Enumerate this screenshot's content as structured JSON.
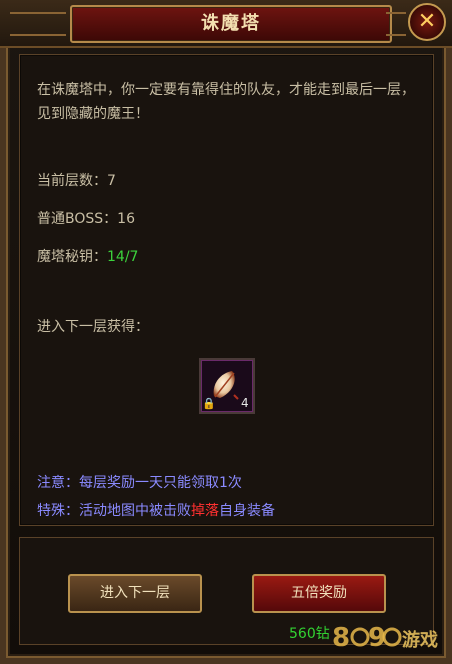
{
  "window": {
    "title": "诛魔塔"
  },
  "description": "在诛魔塔中，你一定要有靠得住的队友，才能走到最后一层，见到隐藏的魔王！",
  "stats": {
    "current_floor_label": "当前层数：",
    "current_floor_value": "7",
    "boss_label": "普通BOSS：",
    "boss_value": "16",
    "key_label": "魔塔秘钥：",
    "key_value": "14/7"
  },
  "reward": {
    "header": "进入下一层获得：",
    "item_count": "4",
    "item_icon": "feather-icon"
  },
  "notes": {
    "note1": "注意：每层奖励一天只能领取1次",
    "note2_prefix": "特殊：活动地图中被击败",
    "note2_highlight": "掉落",
    "note2_suffix": "自身装备"
  },
  "buttons": {
    "next_floor": "进入下一层",
    "five_times": "五倍奖励",
    "price": "560钻"
  },
  "watermark": "8090游戏",
  "colors": {
    "title_bg": "#6e1410",
    "green": "#3cd23c",
    "note_blue": "#8a8aff",
    "red": "#ff3030"
  }
}
